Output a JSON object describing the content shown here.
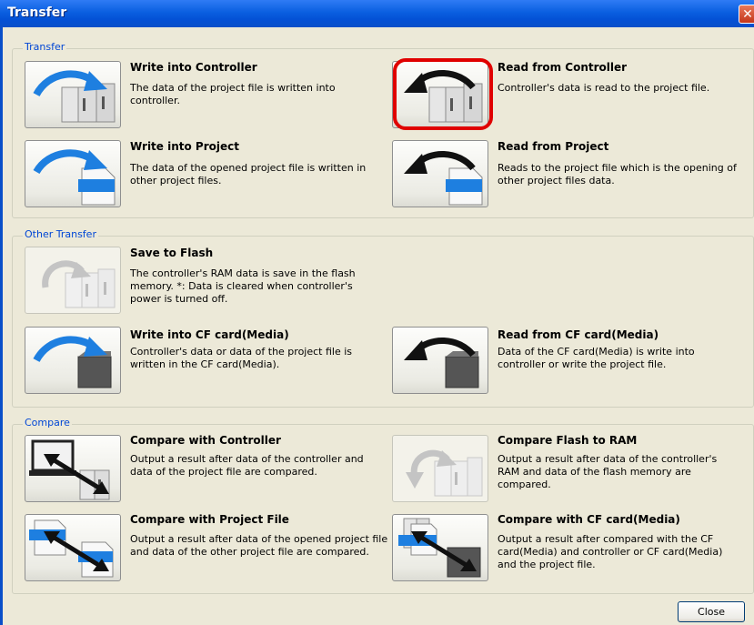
{
  "window": {
    "title": "Transfer",
    "close_glyph": "✕"
  },
  "groups": {
    "transfer": {
      "label": "Transfer"
    },
    "other": {
      "label": "Other Transfer"
    },
    "compare": {
      "label": "Compare"
    }
  },
  "items": {
    "write_controller": {
      "title": "Write into Controller",
      "desc": "The data of the project file is written into controller.",
      "icon": "write-to-controller-icon"
    },
    "read_controller": {
      "title": "Read from Controller",
      "desc": "Controller's data is read to the project file.",
      "icon": "read-from-controller-icon"
    },
    "write_project": {
      "title": "Write into Project",
      "desc": "The data of the opened project file is written in other project files.",
      "icon": "write-to-project-icon"
    },
    "read_project": {
      "title": "Read from Project",
      "desc": "Reads to the project file which is the opening of other project files data.",
      "icon": "read-from-project-icon"
    },
    "save_flash": {
      "title": "Save to Flash",
      "desc": "The controller's RAM data is save in the flash memory. *: Data is cleared when controller's power is turned off.",
      "icon": "save-to-flash-icon"
    },
    "write_cf": {
      "title": "Write into CF card(Media)",
      "desc": "Controller's data or data of the project file is written in the CF card(Media).",
      "icon": "write-to-cf-icon"
    },
    "read_cf": {
      "title": "Read from CF card(Media)",
      "desc": "Data of the CF card(Media) is write into controller or write the project file.",
      "icon": "read-from-cf-icon"
    },
    "compare_controller": {
      "title": "Compare with Controller",
      "desc": "Output a result after data of the controller and data of the project file are compared.",
      "icon": "compare-controller-icon"
    },
    "compare_flash": {
      "title": "Compare Flash to RAM",
      "desc": "Output a result after data of the controller's RAM and data of the flash memory are compared.",
      "icon": "compare-flash-icon"
    },
    "compare_project": {
      "title": "Compare with Project File",
      "desc": "Output a result after data of the opened project file and data of the other project file are compared.",
      "icon": "compare-project-icon"
    },
    "compare_cf": {
      "title": "Compare with CF card(Media)",
      "desc": "Output a result after compared with the CF card(Media) and controller or CF card(Media) and the project file.",
      "icon": "compare-cf-icon"
    }
  },
  "footer": {
    "close_label": "Close"
  },
  "colors": {
    "titlebar": "#0a5fe0",
    "group_label": "#0046d5",
    "highlight": "#e00000",
    "arrow_blue": "#1e7fe0"
  }
}
